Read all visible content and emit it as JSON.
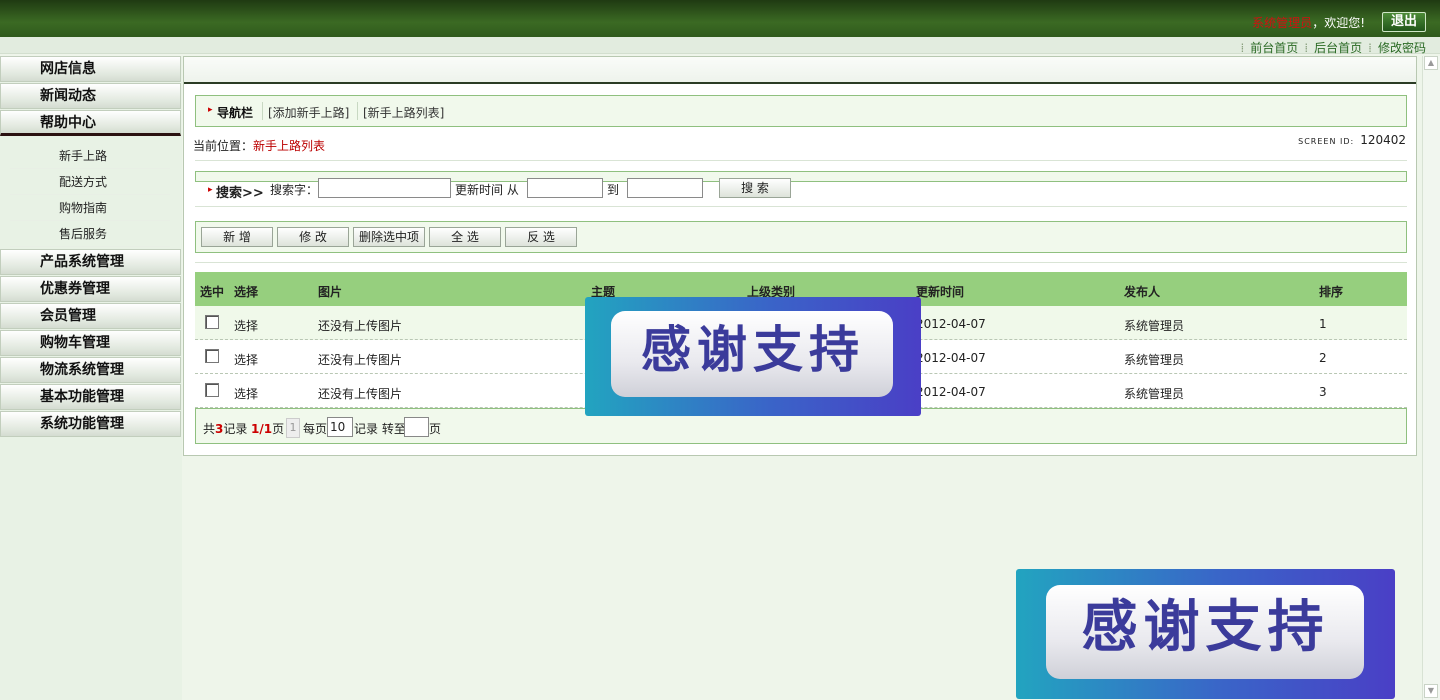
{
  "header": {
    "admin_name": "系统管理员",
    "welcome": "，欢迎您!",
    "logout_label": "退出",
    "links": [
      "前台首页",
      "后台首页",
      "修改密码"
    ]
  },
  "sidebar": {
    "items": [
      {
        "label": "网店信息"
      },
      {
        "label": "新闻动态"
      },
      {
        "label": "帮助中心"
      },
      {
        "label": "产品系统管理"
      },
      {
        "label": "优惠券管理"
      },
      {
        "label": "会员管理"
      },
      {
        "label": "购物车管理"
      },
      {
        "label": "物流系统管理"
      },
      {
        "label": "基本功能管理"
      },
      {
        "label": "系统功能管理"
      }
    ],
    "sub_items": [
      "新手上路",
      "配送方式",
      "购物指南",
      "售后服务"
    ]
  },
  "nav": {
    "title": "导航栏",
    "link_add": "[添加新手上路]",
    "link_list": "[新手上路列表]"
  },
  "crumb": {
    "prefix": "当前位置：",
    "current": "新手上路列表"
  },
  "screen": {
    "label": "SCREEN ID:",
    "id": "120402"
  },
  "search": {
    "label": "搜索>>",
    "keyword_label": "搜索字：",
    "time_from_label": "更新时间 从",
    "time_to_label": "到",
    "button": "搜 索"
  },
  "toolbar": {
    "add": "新 增",
    "edit": "修 改",
    "delete_selected": "删除选中项",
    "select_all": "全 选",
    "invert": "反 选"
  },
  "table": {
    "headers": [
      "选中",
      "选择",
      "图片",
      "主题",
      "上级类别",
      "更新时间",
      "发布人",
      "排序"
    ],
    "rows": [
      {
        "select": "选择",
        "image": "还没有上传图片",
        "topic": "",
        "parent": "",
        "updated": "2012-04-07",
        "author": "系统管理员",
        "order": "1"
      },
      {
        "select": "选择",
        "image": "还没有上传图片",
        "topic": "",
        "parent": "",
        "updated": "2012-04-07",
        "author": "系统管理员",
        "order": "2"
      },
      {
        "select": "选择",
        "image": "还没有上传图片",
        "topic": "",
        "parent": "",
        "updated": "2012-04-07",
        "author": "系统管理员",
        "order": "3"
      }
    ]
  },
  "pager": {
    "total_prefix": "共",
    "total": "3",
    "total_suffix": "记录",
    "page_current": "1",
    "page_slash": "/",
    "page_total": "1",
    "page_suffix": "页",
    "page_box": "1",
    "per_page_label": "每页",
    "per_page_value": "10",
    "goto_label": "记录 转至",
    "goto_suffix": "页"
  },
  "overlay": {
    "text": "感谢支持"
  },
  "colors": {
    "header_green": "#2f5a1c",
    "table_head": "#96cf7e",
    "accent_red": "#cc0000"
  }
}
